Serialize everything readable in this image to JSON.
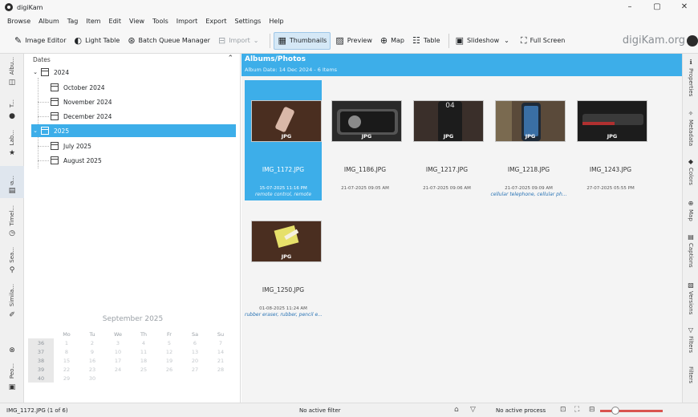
{
  "window": {
    "title": "digiKam",
    "controls": {
      "minimize": "–",
      "maximize": "▢",
      "close": "✕"
    }
  },
  "menu": [
    "Browse",
    "Album",
    "Tag",
    "Item",
    "Edit",
    "View",
    "Tools",
    "Import",
    "Export",
    "Settings",
    "Help"
  ],
  "toolbar": {
    "image_editor": "Image Editor",
    "light_table": "Light Table",
    "batch_queue_manager": "Batch Queue Manager",
    "import": "Import",
    "thumbnails": "Thumbnails",
    "preview": "Preview",
    "map": "Map",
    "table": "Table",
    "slideshow": "Slideshow",
    "full_screen": "Full Screen",
    "brand": "digiKam.org"
  },
  "left_tabs": {
    "albums": "Albu...",
    "tags": "T...",
    "labels": "Lab...",
    "dates": "Da...",
    "timeline": "Timel...",
    "search": "Sea...",
    "similarity": "Simila...",
    "people": "Peo..."
  },
  "dates_panel": {
    "header": "Dates",
    "year_2024": "2024",
    "months_2024": [
      "October 2024",
      "November 2024",
      "December 2024"
    ],
    "year_2025": "2025",
    "months_2025": [
      "July 2025",
      "August 2025"
    ]
  },
  "calendar": {
    "title": "September 2025",
    "weekdays": [
      "Mo",
      "Tu",
      "We",
      "Th",
      "Fr",
      "Sa",
      "Su"
    ],
    "weeks": [
      {
        "wk": "36",
        "days": [
          "1",
          "2",
          "3",
          "4",
          "5",
          "6",
          "7"
        ]
      },
      {
        "wk": "37",
        "days": [
          "8",
          "9",
          "10",
          "11",
          "12",
          "13",
          "14"
        ]
      },
      {
        "wk": "38",
        "days": [
          "15",
          "16",
          "17",
          "18",
          "19",
          "20",
          "21"
        ]
      },
      {
        "wk": "39",
        "days": [
          "22",
          "23",
          "24",
          "25",
          "26",
          "27",
          "28"
        ]
      },
      {
        "wk": "40",
        "days": [
          "29",
          "30",
          "",
          "",
          "",
          "",
          ""
        ]
      }
    ]
  },
  "main": {
    "title": "Albums/Photos",
    "subtitle": "Album Date: 14 Dec 2024 - 6 Items",
    "items": [
      {
        "name": "IMG_1172.JPG",
        "date": "15-07-2025 11:16 PM",
        "tags": "remote control, remote",
        "badge": "JPG",
        "selected": true
      },
      {
        "name": "IMG_1186.JPG",
        "date": "21-07-2025 09:05 AM",
        "tags": "",
        "badge": "JPG",
        "selected": false
      },
      {
        "name": "IMG_1217.JPG",
        "date": "21-07-2025 09:06 AM",
        "tags": "",
        "badge": "JPG",
        "selected": false
      },
      {
        "name": "IMG_1218.JPG",
        "date": "21-07-2025 09:09 AM",
        "tags": "cellular telephone, cellular ph...",
        "badge": "JPG",
        "selected": false
      },
      {
        "name": "IMG_1243.JPG",
        "date": "27-07-2025 05:55 PM",
        "tags": "",
        "badge": "JPG",
        "selected": false
      },
      {
        "name": "IMG_1250.JPG",
        "date": "01-08-2025 11:24 AM",
        "tags": "rubber eraser, rubber, pencil e...",
        "badge": "JPG",
        "selected": false
      }
    ]
  },
  "right_tabs": [
    "Properties",
    "Metadata",
    "Colors",
    "Map",
    "Captions",
    "Versions",
    "Filters",
    "Filters"
  ],
  "status": {
    "selection": "IMG_1172.JPG (1 of 6)",
    "filter": "No active filter",
    "process": "No active process"
  },
  "colors": {
    "accent": "#3daee9",
    "tag_text": "#2a74b5"
  }
}
